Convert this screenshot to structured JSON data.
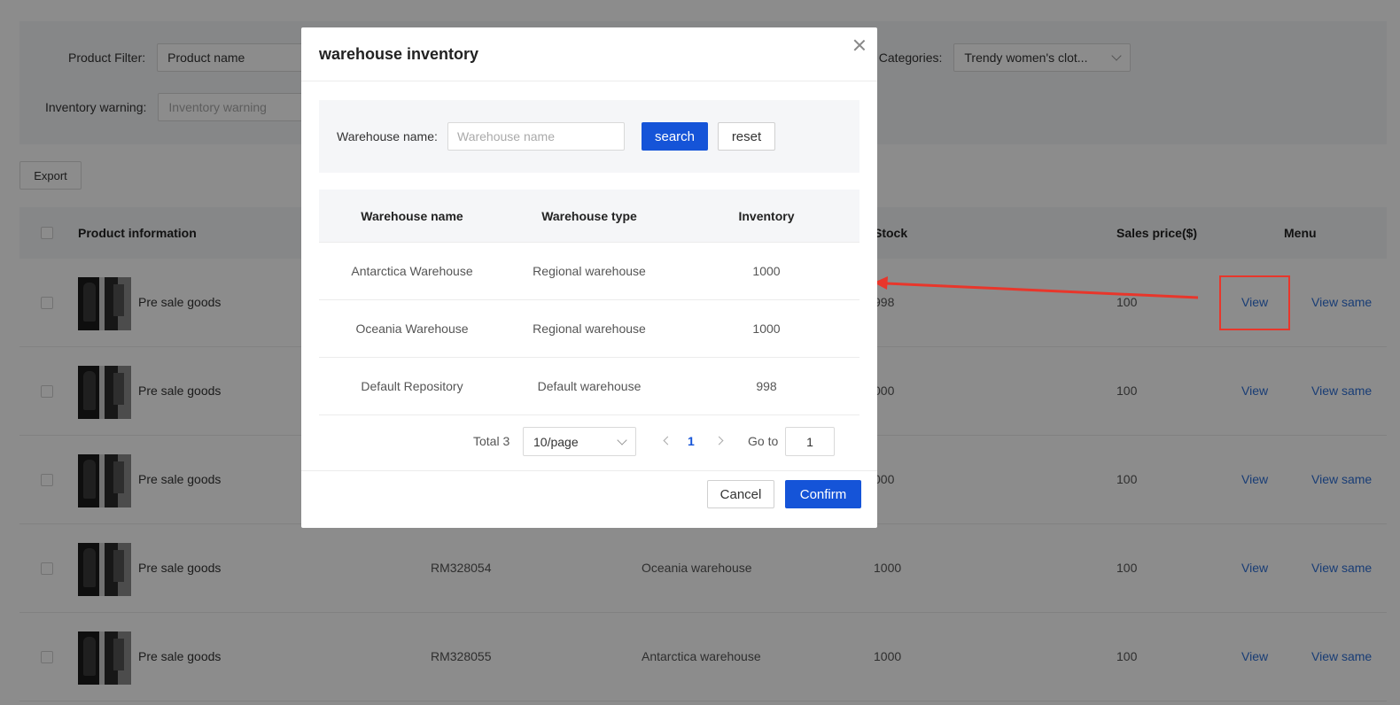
{
  "filters": {
    "product_filter_label": "Product Filter:",
    "product_filter_value": "Product name",
    "categories_label": "ct Categories:",
    "categories_value": "Trendy women's clot...",
    "inventory_warning_label": "Inventory warning:",
    "inventory_warning_placeholder": "Inventory warning"
  },
  "export_label": "Export",
  "table": {
    "headers": {
      "product_info": "Product information",
      "stock": "Stock",
      "sales_price": "Sales price($)",
      "menu": "Menu"
    },
    "rows": [
      {
        "name": "Pre sale goods",
        "code": "",
        "warehouse": "",
        "stock": "998",
        "price": "100",
        "view": "View",
        "view_same": "View same"
      },
      {
        "name": "Pre sale goods",
        "code": "",
        "warehouse": "",
        "stock": "000",
        "price": "100",
        "view": "View",
        "view_same": "View same"
      },
      {
        "name": "Pre sale goods",
        "code": "",
        "warehouse": "",
        "stock": "000",
        "price": "100",
        "view": "View",
        "view_same": "View same"
      },
      {
        "name": "Pre sale goods",
        "code": "RM328054",
        "warehouse": "Oceania warehouse",
        "stock": "1000",
        "price": "100",
        "view": "View",
        "view_same": "View same"
      },
      {
        "name": "Pre sale goods",
        "code": "RM328055",
        "warehouse": "Antarctica warehouse",
        "stock": "1000",
        "price": "100",
        "view": "View",
        "view_same": "View same"
      }
    ]
  },
  "modal": {
    "title": "warehouse inventory",
    "search_label": "Warehouse name:",
    "search_placeholder": "Warehouse name",
    "search_button": "search",
    "reset_button": "reset",
    "columns": {
      "name": "Warehouse name",
      "type": "Warehouse type",
      "inventory": "Inventory"
    },
    "rows": [
      {
        "name": "Antarctica Warehouse",
        "type": "Regional warehouse",
        "inventory": "1000"
      },
      {
        "name": "Oceania Warehouse",
        "type": "Regional warehouse",
        "inventory": "1000"
      },
      {
        "name": "Default Repository",
        "type": "Default warehouse",
        "inventory": "998"
      }
    ],
    "pagination": {
      "total": "Total 3",
      "page_size": "10/page",
      "current_page": "1",
      "goto_label": "Go to",
      "goto_value": "1"
    },
    "cancel_button": "Cancel",
    "confirm_button": "Confirm"
  },
  "colors": {
    "primary": "#1554d8",
    "link": "#2f6fd6",
    "annotation": "#e8362b"
  }
}
